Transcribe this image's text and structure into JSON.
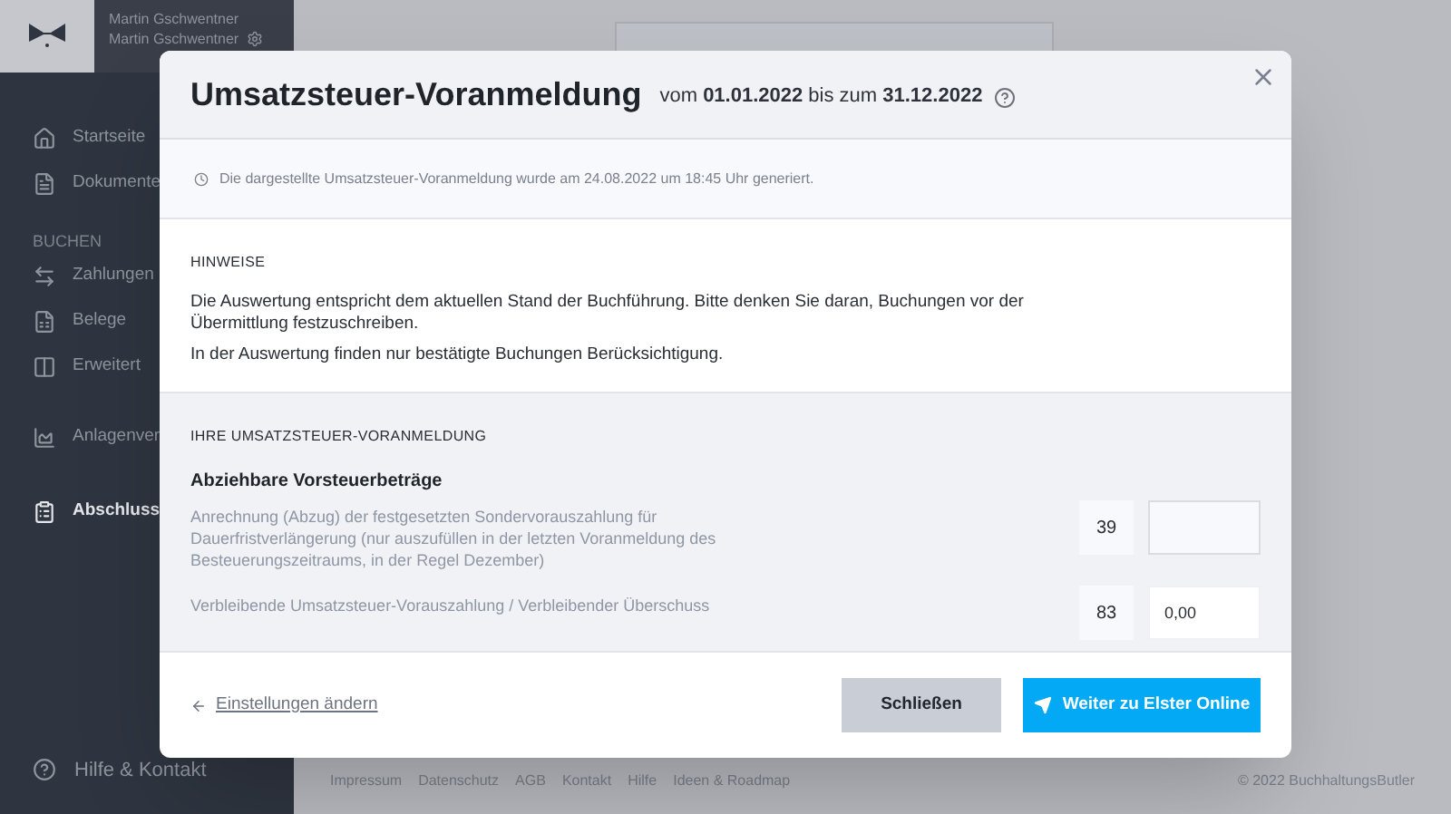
{
  "sidebar": {
    "user_name": "Martin Gschwentner",
    "account_name": "Martin Gschwentner",
    "items": [
      {
        "label": "Startseite",
        "selected": false
      },
      {
        "label": "Dokumente",
        "selected": false
      },
      {
        "kind": "heading",
        "label": "BUCHEN"
      },
      {
        "label": "Zahlungen",
        "selected": false
      },
      {
        "label": "Belege",
        "selected": false
      },
      {
        "label": "Erweitert",
        "selected": false
      },
      {
        "label": "Anlagenver",
        "selected": false
      },
      {
        "label": "Abschluss",
        "selected": true
      }
    ],
    "help": "Hilfe & Kontakt"
  },
  "footer": {
    "links": [
      "Impressum",
      "Datenschutz",
      "AGB",
      "Kontakt",
      "Hilfe",
      "Ideen & Roadmap"
    ],
    "copyright": "© 2022 BuchhaltungsButler"
  },
  "dialog": {
    "title": "Umsatzsteuer-Voranmeldung",
    "subtitle": "vom **01.01.2022** bis zum **31.12.2022**",
    "info": "Die dargestellte Umsatzsteuer-Voranmeldung wurde am 24.08.2022 um 18:45 Uhr generiert.",
    "notes_heading": "HINWEISE",
    "notes": [
      "Die Auswertung entspricht dem aktuellen Stand der Buchführung. Bitte denken Sie daran, Buchungen vor der Übermittlung festzuschreiben.",
      "In der Auswertung finden nur bestätigte Buchungen Berücksichtigung."
    ],
    "section_heading": "IHRE UMSATZSTEUER-VORANMELDUNG",
    "group_title": "Abziehbare Vorsteuerbeträge",
    "rows": [
      {
        "label": "Anrechnung (Abzug) der festgesetzten Sondervorauszahlung für Dauerfristverlängerung (nur auszufüllen in der letzten Voranmeldung des Besteuerungszeitraums, in der Regel Dezember)",
        "code": "39",
        "disabled": true
      },
      {
        "label": "Verbleibende Umsatzsteuer-Vorauszahlung / Verbleibender Überschuss",
        "code": "83",
        "value": "0,00",
        "disabled": false
      }
    ],
    "back_link": "Einstellungen ändern",
    "buttons": [
      {
        "kind": "secondary",
        "label": "Schließen"
      },
      {
        "kind": "primary",
        "label": "Weiter zu Elster Online"
      }
    ]
  }
}
